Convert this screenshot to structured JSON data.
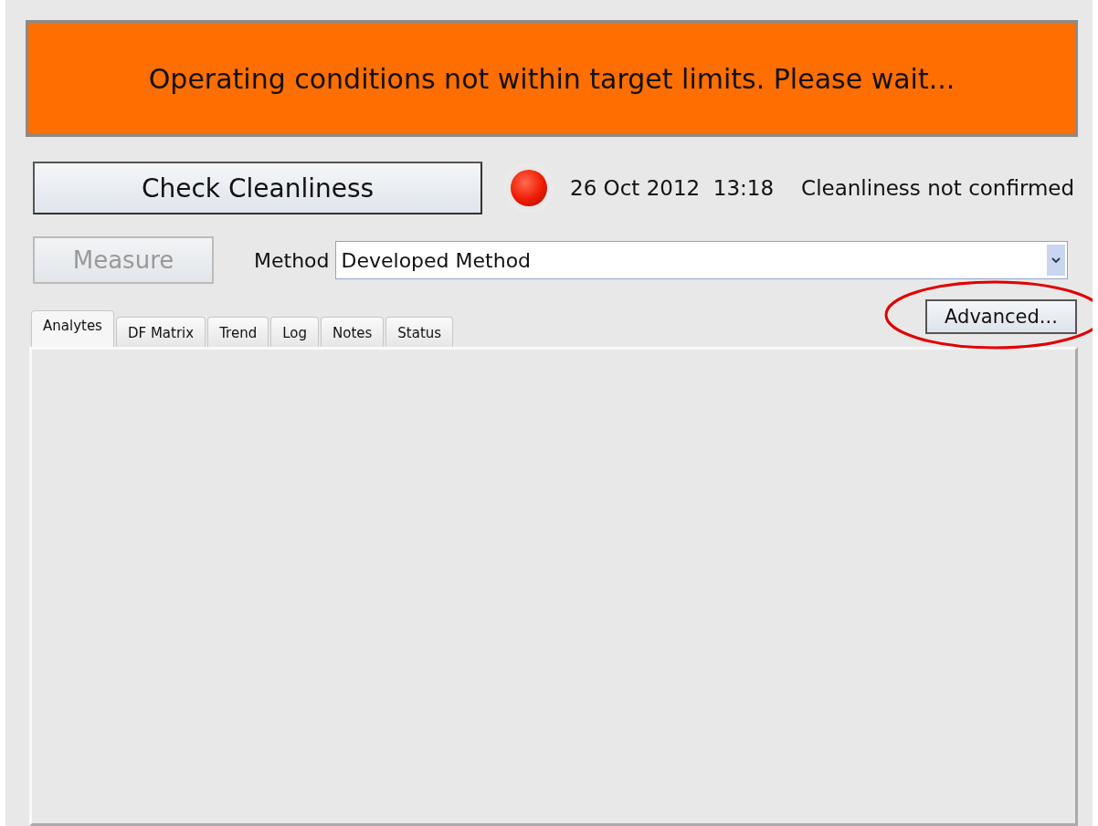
{
  "banner": {
    "message": "Operating conditions not within target limits. Please wait..."
  },
  "check_button": {
    "label": "Check  Cleanliness"
  },
  "indicator": {
    "on": true
  },
  "timestamp": "26 Oct 2012  13:18",
  "status_text": "Cleanliness not confirmed",
  "measure_button": {
    "label": "Measure",
    "disabled": true
  },
  "method": {
    "label": "Method",
    "value": "Developed Method"
  },
  "advanced_button": {
    "label": "Advanced...",
    "highlighted": true
  },
  "tabs": [
    {
      "label": "Analytes",
      "selected": true
    },
    {
      "label": "DF Matrix",
      "selected": false
    },
    {
      "label": "Trend",
      "selected": false
    },
    {
      "label": "Log",
      "selected": false
    },
    {
      "label": "Notes",
      "selected": false
    },
    {
      "label": "Status",
      "selected": false
    }
  ]
}
